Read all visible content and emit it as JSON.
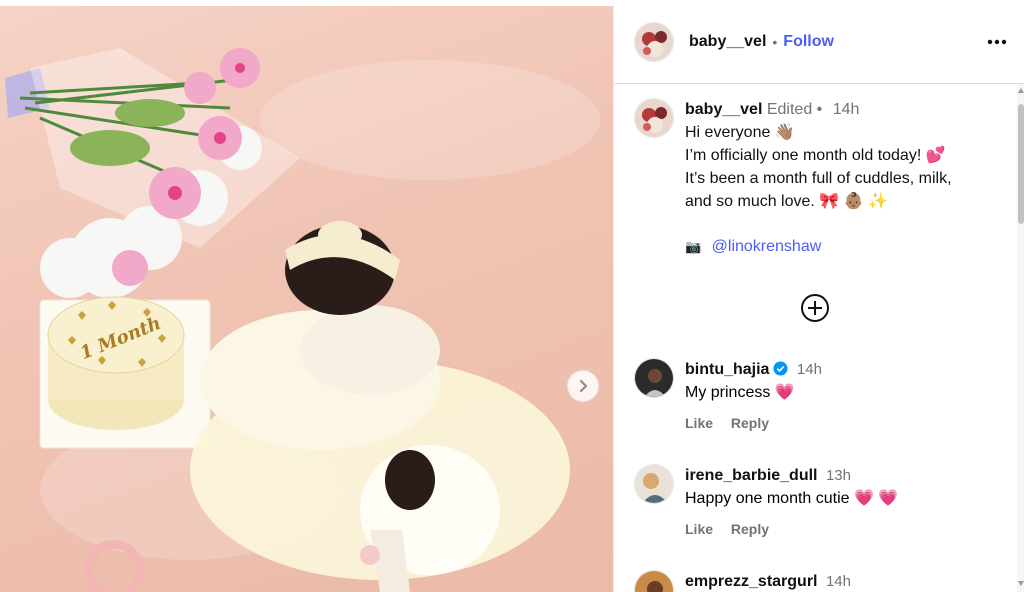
{
  "post": {
    "username": "baby__vel",
    "separator": "•",
    "follow_label": "Follow",
    "more_icon": "more-horizontal-icon"
  },
  "caption": {
    "username": "baby__vel",
    "edited": "Edited",
    "separator": "•",
    "time": "14h",
    "lines": [
      "Hi everyone 👋🏽",
      "I’m officially one month old today! 💕",
      "It’s been a month full of cuddles, milk,",
      "and so much love. 🎀 👶🏽 ✨"
    ],
    "credit_icon": "📷",
    "credit_mention": "@linokrenshaw"
  },
  "comments": [
    {
      "username": "bintu_hajia",
      "verified": true,
      "time": "14h",
      "text": "My princess",
      "emoji": "💗",
      "like": "Like",
      "reply": "Reply"
    },
    {
      "username": "irene_barbie_dull",
      "verified": false,
      "time": "13h",
      "text": "Happy one month cutie",
      "emoji": "💗 💗",
      "like": "Like",
      "reply": "Reply"
    },
    {
      "username": "emprezz_stargurl",
      "verified": false,
      "time": "14h"
    }
  ],
  "media": {
    "cake_text": "1 Month",
    "next_icon": "chevron-right-icon"
  },
  "colors": {
    "accent": "#4a5df9",
    "verified": "#0095f6",
    "heart": "#ec3f72",
    "muted": "#737373"
  }
}
